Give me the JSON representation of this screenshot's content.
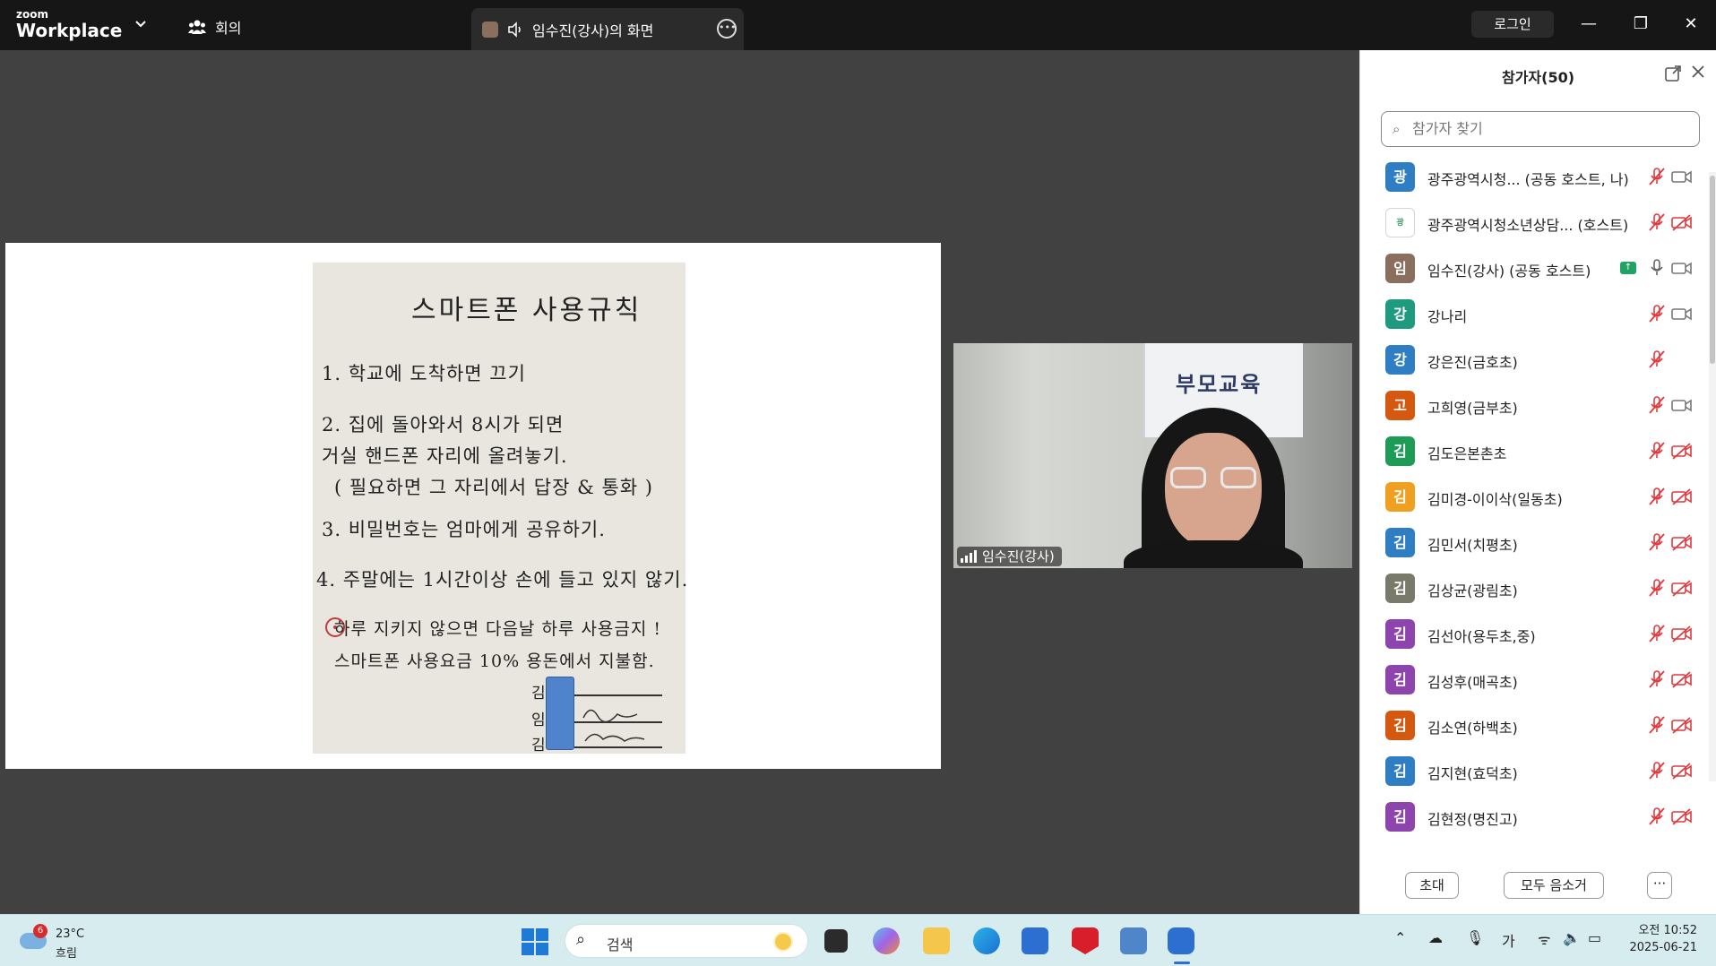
{
  "app": {
    "brand_small": "zoom",
    "brand_large": "Workplace",
    "meeting_tab": "회의",
    "share_tab": "임수진(강사)의 화면",
    "login": "로그인",
    "minimize": "—",
    "restore": "❐",
    "close": "✕"
  },
  "shared_doc": {
    "title": "스마트폰 사용규칙",
    "lines": [
      "1.  학교에 도착하면 끄기",
      "2.  집에 돌아와서 8시가 되면",
      "     거실 핸드폰 자리에 올려놓기.",
      "  ( 필요하면 그 자리에서 답장 & 통화 )",
      "3.  비밀번호는 엄마에게 공유하기.",
      "4.  주말에는 1시간이상 손에 들고 있지 않기.",
      "   하루 지키지 않으면 다음날 하루 사용금지 !",
      "   스마트폰 사용요금 10% 용돈에서 지불함."
    ],
    "signature_initials": [
      "김",
      "임",
      "김"
    ]
  },
  "video": {
    "name": "임수진(강사)",
    "banner_title": "부모교육"
  },
  "panel": {
    "title": "참가자(50)",
    "search_placeholder": "참가자 찾기",
    "invite": "초대",
    "mute_all": "모두 음소거",
    "more": "···",
    "participants": [
      {
        "initial": "광",
        "name": "광주광역시청...  (공동 호스트, 나)",
        "color": "#2f7dc2",
        "mic": "muted",
        "cam": "on"
      },
      {
        "initial": "광",
        "name": "광주광역시청소년상담...  (호스트)",
        "color": "#ffffff",
        "mic": "muted",
        "cam": "off"
      },
      {
        "initial": "임",
        "name": "임수진(강사) (공동 호스트)",
        "color": "#8a6e5e",
        "mic": "on",
        "cam": "on",
        "sharing": true
      },
      {
        "initial": "강",
        "name": "강나리",
        "color": "#1e9b7e",
        "mic": "muted",
        "cam": "on"
      },
      {
        "initial": "강",
        "name": "강은진(금호초)",
        "color": "#2f7dc2",
        "mic": "muted",
        "cam": "none"
      },
      {
        "initial": "고",
        "name": "고희영(금부초)",
        "color": "#d4580f",
        "mic": "muted",
        "cam": "on"
      },
      {
        "initial": "김",
        "name": "김도은본촌초",
        "color": "#1e9b56",
        "mic": "muted",
        "cam": "off"
      },
      {
        "initial": "김",
        "name": "김미경-이이삭(일동초)",
        "color": "#f0a020",
        "mic": "muted",
        "cam": "off"
      },
      {
        "initial": "김",
        "name": "김민서(치평초)",
        "color": "#2f7dc2",
        "mic": "muted",
        "cam": "off"
      },
      {
        "initial": "김",
        "name": "김상균(광림초)",
        "color": "#7a7a6a",
        "mic": "muted",
        "cam": "off"
      },
      {
        "initial": "김",
        "name": "김선아(용두초,중)",
        "color": "#8e44ad",
        "mic": "muted",
        "cam": "off"
      },
      {
        "initial": "김",
        "name": "김성후(매곡초)",
        "color": "#8e44ad",
        "mic": "muted",
        "cam": "off"
      },
      {
        "initial": "김",
        "name": "김소연(하백초)",
        "color": "#d4580f",
        "mic": "muted",
        "cam": "off"
      },
      {
        "initial": "김",
        "name": "김지현(효덕초)",
        "color": "#2f7dc2",
        "mic": "muted",
        "cam": "off"
      },
      {
        "initial": "김",
        "name": "김현정(명진고)",
        "color": "#8e44ad",
        "mic": "muted",
        "cam": "off"
      }
    ]
  },
  "taskbar": {
    "weather_badge": "6",
    "temperature": "23°C",
    "condition": "흐림",
    "search": "검색",
    "ime": "가",
    "time": "오전 10:52",
    "date": "2025-06-21"
  }
}
